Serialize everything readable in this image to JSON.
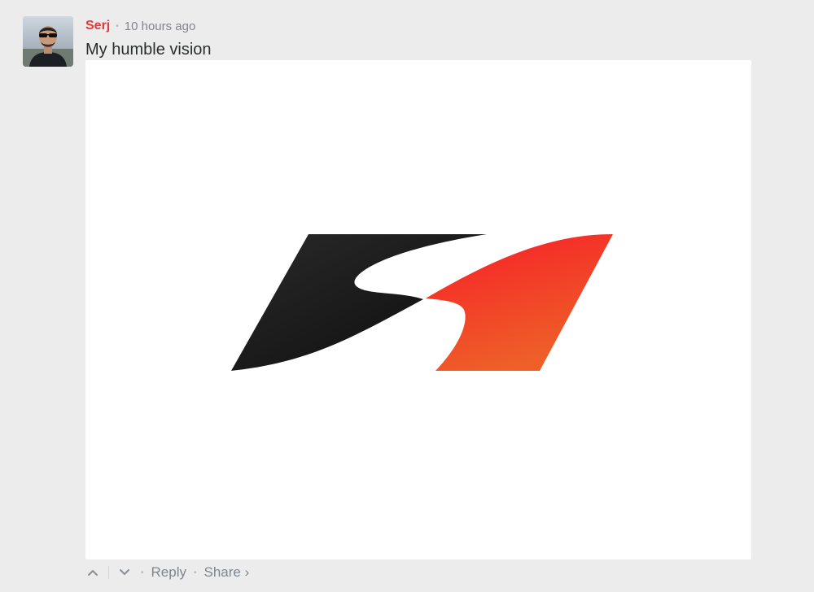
{
  "comment": {
    "author": "Serj",
    "separator": "•",
    "timestamp": "10 hours ago",
    "message": "My humble vision"
  },
  "footer": {
    "separator": "•",
    "reply_label": "Reply",
    "share_label": "Share ›"
  },
  "colors": {
    "background": "#ececec",
    "author": "#e03a3a",
    "muted": "#7f868d",
    "logo_dark": "#1a1a1a",
    "logo_red": "#f5222a",
    "logo_orange": "#f0582a"
  },
  "icons": {
    "upvote": "chevron-up-icon",
    "downvote": "chevron-down-icon"
  }
}
